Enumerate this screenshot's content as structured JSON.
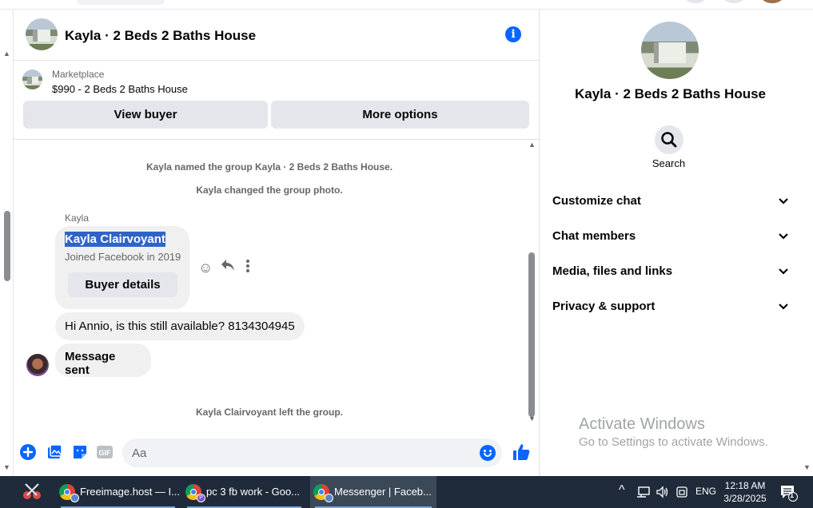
{
  "chat": {
    "header_title": "Kayla · 2 Beds 2 Baths House",
    "marketplace_label": "Marketplace",
    "listing": "$990 - 2 Beds 2 Baths House",
    "view_buyer": "View buyer",
    "more_options": "More options",
    "system_messages": [
      "Kayla named the group Kayla · 2 Beds 2 Baths House.",
      "Kayla changed the group photo.",
      "Kayla Clairvoyant left the group."
    ],
    "sender": "Kayla",
    "card": {
      "name": "Kayla Clairvoyant",
      "joined": "Joined Facebook in 2019",
      "button": "Buyer details"
    },
    "messages": [
      "Hi Annio, is this still available? 8134304945",
      "Message sent"
    ],
    "composer_placeholder": "Aa"
  },
  "right_panel": {
    "title": "Kayla · 2 Beds 2 Baths House",
    "search_label": "Search",
    "sections": [
      "Customize chat",
      "Chat members",
      "Media, files and links",
      "Privacy & support"
    ]
  },
  "watermark": {
    "line1": "Activate Windows",
    "line2": "Go to Settings to activate Windows."
  },
  "taskbar": {
    "items": [
      {
        "label": "Freeimage.host — I...",
        "profile": ""
      },
      {
        "label": "pc 3 fb work - Goo...",
        "profile": "P"
      },
      {
        "label": "Messenger | Faceb...",
        "profile": ""
      }
    ],
    "language": "ENG",
    "time": "12:18 AM",
    "date": "3/28/2025",
    "notification_count": "1"
  },
  "colors": {
    "accent": "#0866ff",
    "bubble": "#f0f0f0",
    "button": "#e4e6eb",
    "taskbar": "#1f2b3a"
  }
}
